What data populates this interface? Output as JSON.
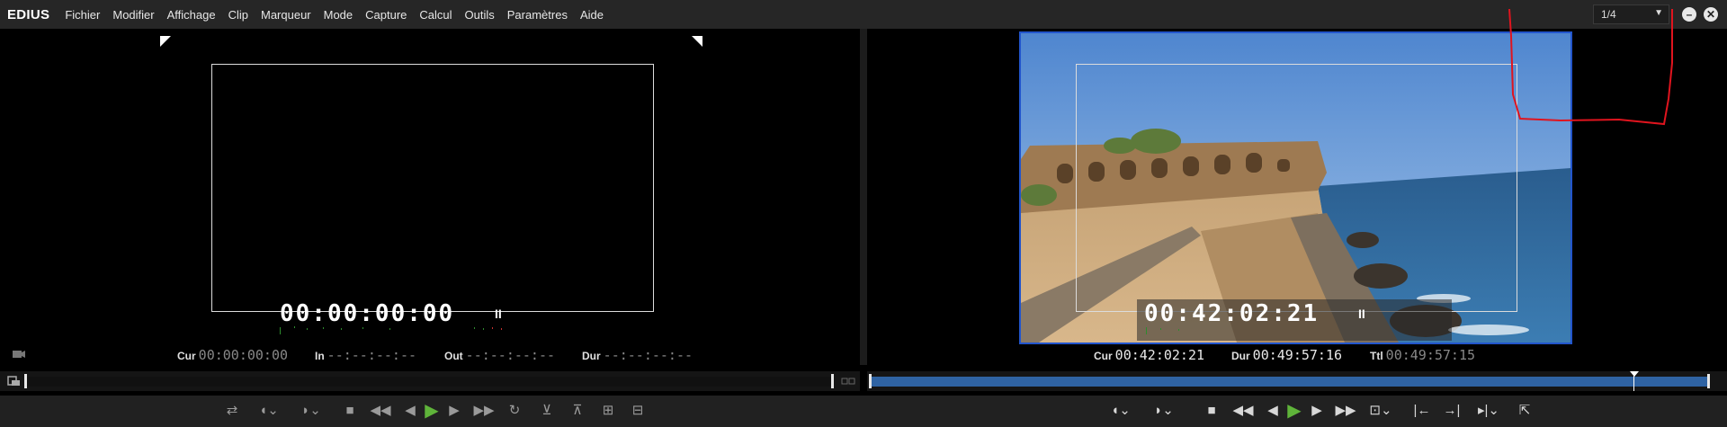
{
  "app": {
    "brand": "EDIUS",
    "menu": [
      "Fichier",
      "Modifier",
      "Affichage",
      "Clip",
      "Marqueur",
      "Mode",
      "Capture",
      "Calcul",
      "Outils",
      "Paramètres",
      "Aide"
    ],
    "zoom_value": "1/4"
  },
  "player": {
    "timecode_overlay": "00:00:00:00",
    "pause_symbol": "II",
    "cur_label": "Cur",
    "cur_value": "00:00:00:00",
    "in_label": "In",
    "in_value": "--:--:--:--",
    "out_label": "Out",
    "out_value": "--:--:--:--",
    "dur_label": "Dur",
    "dur_value": "--:--:--:--"
  },
  "recorder": {
    "timecode_overlay": "00:42:02:21",
    "pause_symbol": "II",
    "cur_label": "Cur",
    "cur_value": "00:42:02:21",
    "dur_label": "Dur",
    "dur_value": "00:49:57:16",
    "ttl_label": "Ttl",
    "ttl_value": "00:49:57:15",
    "scrub_position": 0.91
  },
  "colors": {
    "timeline_fill": "#2f63a3",
    "play_green": "#5fb43a",
    "annotation_red": "#e0141e",
    "frame_border": "#2255cc"
  }
}
